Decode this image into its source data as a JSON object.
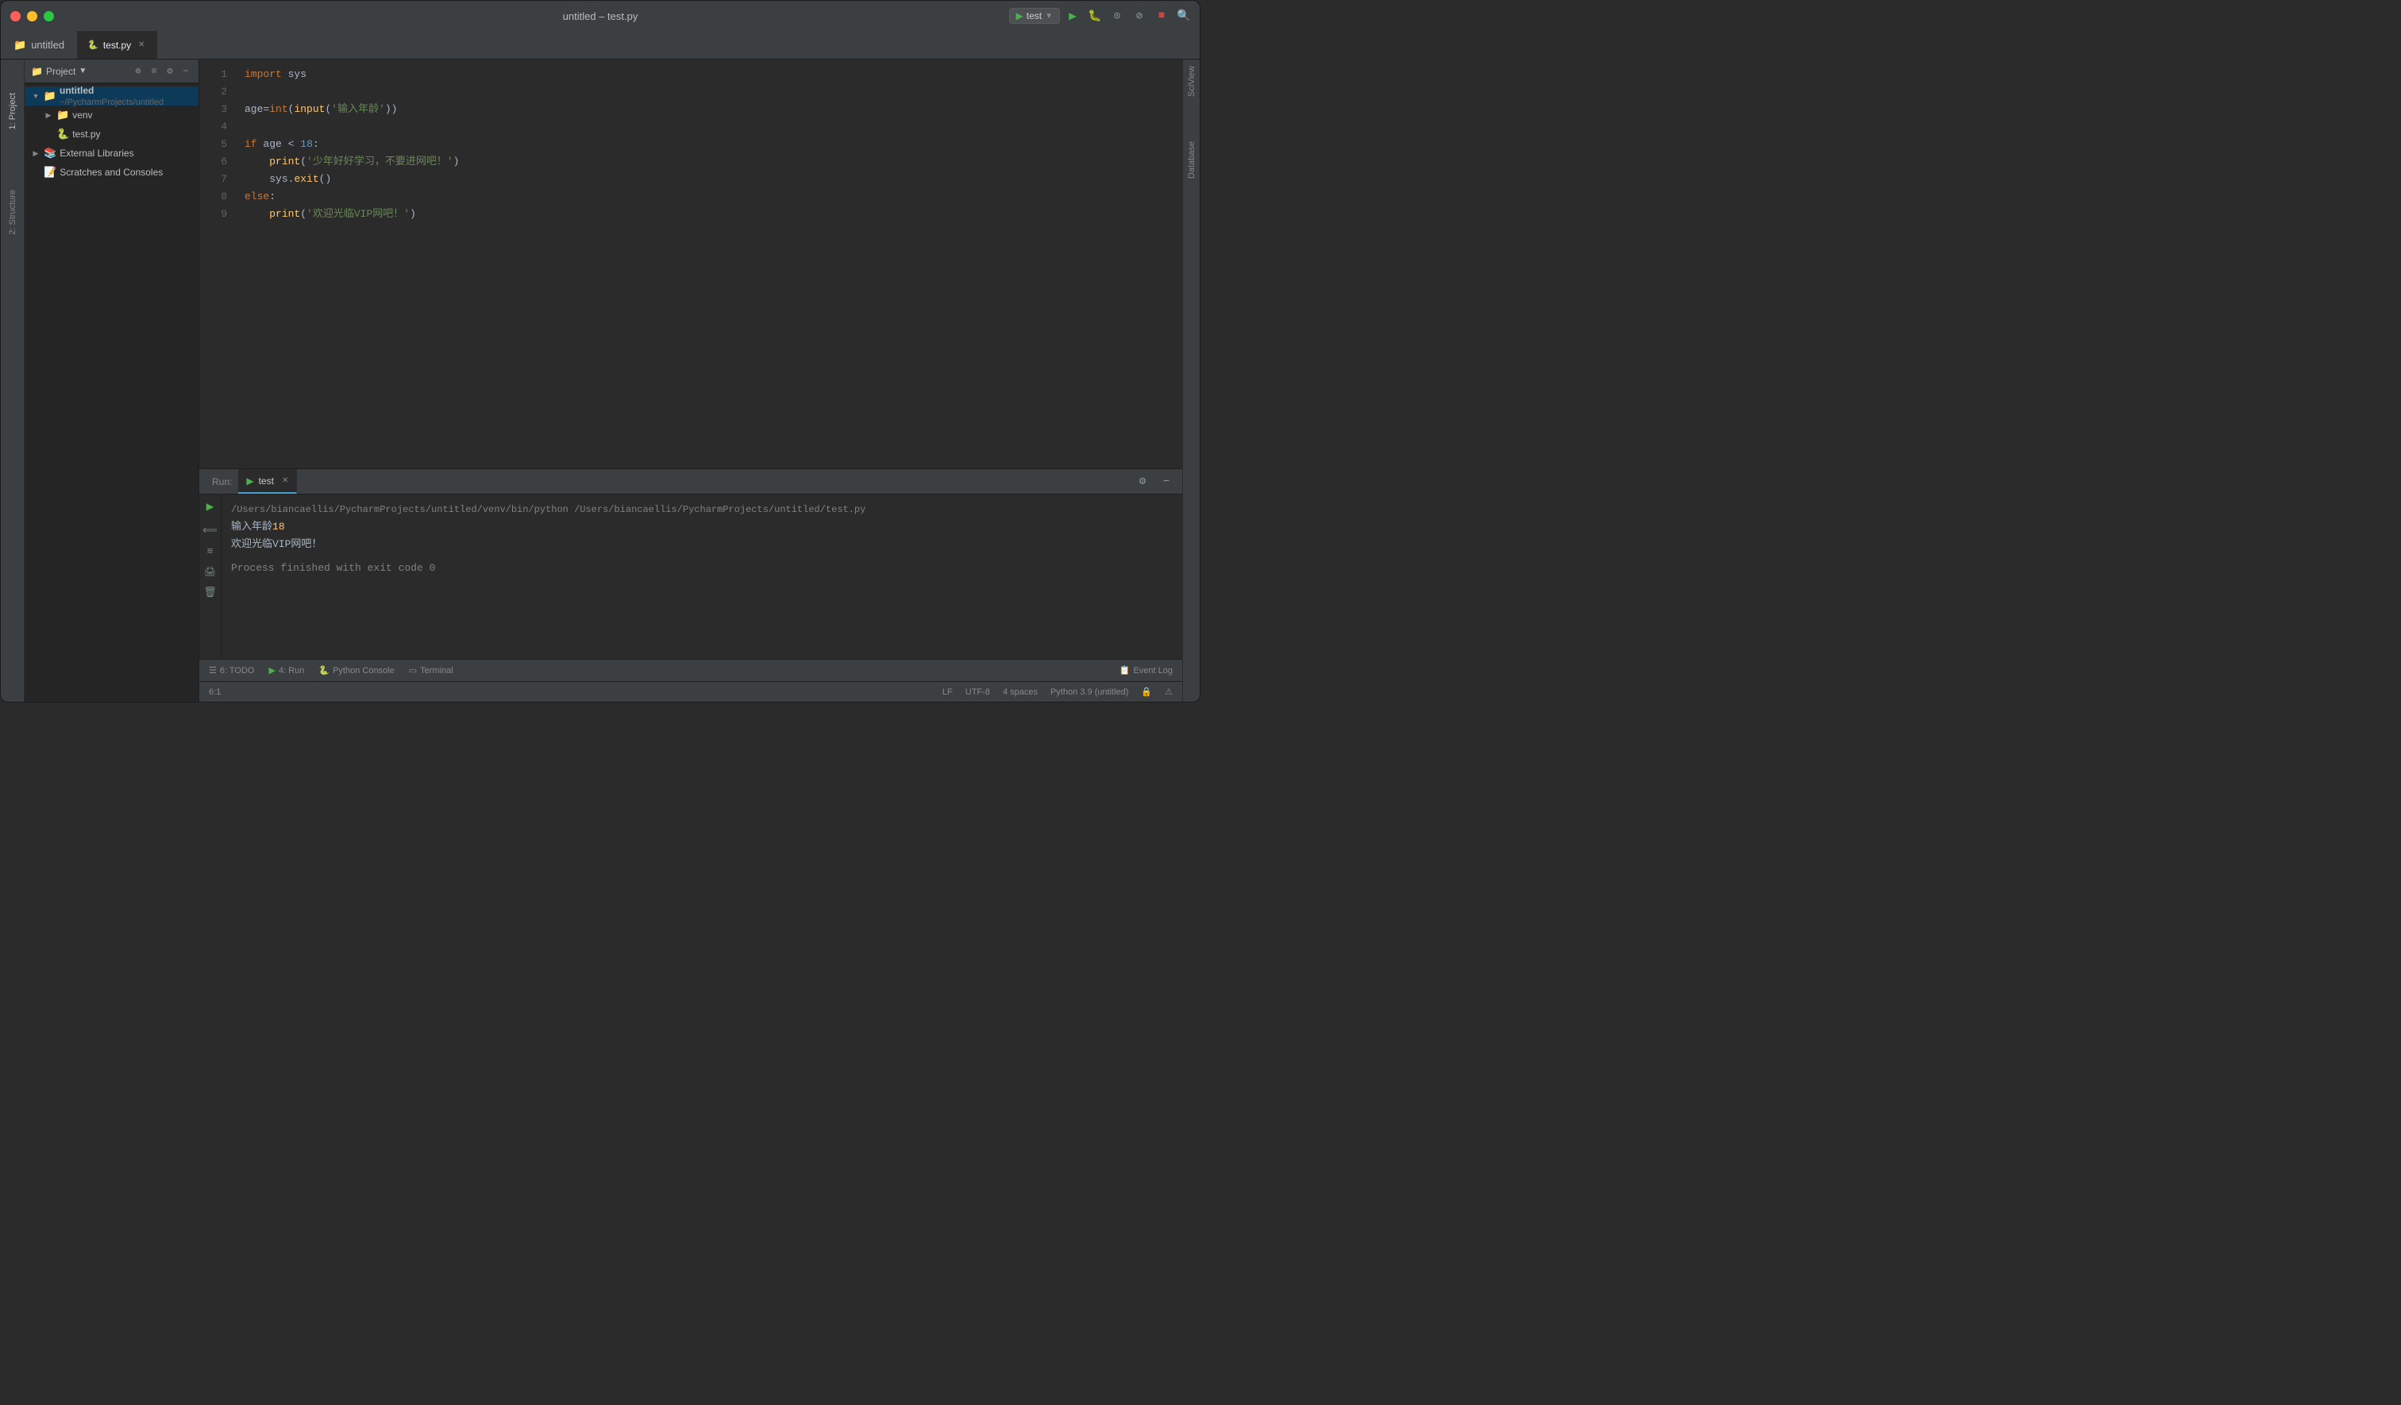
{
  "window": {
    "title": "untitled – test.py"
  },
  "titlebar": {
    "title": "untitled – test.py"
  },
  "tabs": {
    "project_tab": "untitled",
    "editor_tab": "test.py"
  },
  "toolbar": {
    "run_config": "test",
    "run_label": "▶",
    "icons": [
      "gear",
      "clock",
      "database",
      "format",
      "search"
    ]
  },
  "project_panel": {
    "title": "Project",
    "root": {
      "name": "untitled",
      "path": "~/PycharmProjects/untitled",
      "children": [
        {
          "name": "venv",
          "type": "folder"
        },
        {
          "name": "test.py",
          "type": "python"
        }
      ]
    },
    "external_libraries": "External Libraries",
    "scratches": "Scratches and Consoles"
  },
  "editor": {
    "filename": "test.py",
    "lines": [
      {
        "num": 1,
        "code": "import sys"
      },
      {
        "num": 2,
        "code": ""
      },
      {
        "num": 3,
        "code": "age=int(input('输入年龄'))"
      },
      {
        "num": 4,
        "code": ""
      },
      {
        "num": 5,
        "code": "if age < 18:"
      },
      {
        "num": 6,
        "code": "    print('少年好好学习，不要进网吧！')"
      },
      {
        "num": 7,
        "code": "    sys.exit()"
      },
      {
        "num": 8,
        "code": "else:"
      },
      {
        "num": 9,
        "code": "    print('欢迎光临VIP网吧！')"
      }
    ]
  },
  "run_panel": {
    "label": "Run:",
    "tab": "test",
    "command": "/Users/biancaellis/PycharmProjects/untitled/venv/bin/python /Users/biancaellis/PycharmProjects/untitled/test.py",
    "prompt_text": "输入年龄",
    "input_value": "18",
    "output1": "欢迎光临VIP网吧！",
    "process_msg": "Process finished with exit code 0"
  },
  "bottom_tools": {
    "todo": "6: TODO",
    "run": "4: Run",
    "python_console": "Python Console",
    "terminal": "Terminal",
    "event_log": "Event Log"
  },
  "status_bar": {
    "line_col": "6:1",
    "line_ending": "LF",
    "encoding": "UTF-8",
    "indent": "4 spaces",
    "python": "Python 3.9 (untitled)"
  },
  "side_panels": {
    "left_project": "1: Project",
    "left_structure": "2: Structure",
    "right_sciview": "SciView",
    "right_database": "Database"
  }
}
